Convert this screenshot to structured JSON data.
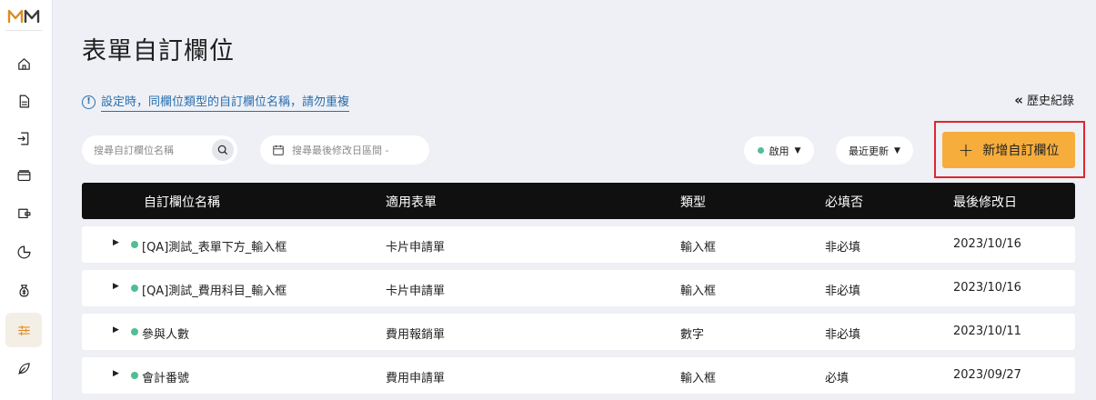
{
  "brand": {
    "logo_text": "MM",
    "accent": "#e08a23"
  },
  "sidebar": {
    "items": [
      {
        "icon": "home-icon"
      },
      {
        "icon": "document-icon"
      },
      {
        "icon": "import-icon"
      },
      {
        "icon": "card-icon"
      },
      {
        "icon": "wallet-icon"
      },
      {
        "icon": "pie-chart-icon"
      },
      {
        "icon": "money-bag-icon"
      },
      {
        "icon": "sliders-icon",
        "active": true
      },
      {
        "icon": "leaf-icon"
      }
    ]
  },
  "page": {
    "title": "表單自訂欄位",
    "notice": "設定時，同欄位類型的自訂欄位名稱，請勿重複",
    "history_label": "歷史紀錄"
  },
  "toolbar": {
    "search_placeholder": "搜尋自訂欄位名稱",
    "date_placeholder": "搜尋最後修改日區間 -",
    "status_label": "啟用",
    "sort_label": "最近更新",
    "add_button_label": "新增自訂欄位",
    "highlight_color": "#e0252f",
    "button_color": "#f6ad3c"
  },
  "table": {
    "columns": [
      "自訂欄位名稱",
      "適用表單",
      "類型",
      "必填否",
      "最後修改日"
    ],
    "rows": [
      {
        "name": "[QA]測試_表單下方_輸入框",
        "form": "卡片申請單",
        "type": "輸入框",
        "required": "非必填",
        "date": "2023/10/16"
      },
      {
        "name": "[QA]測試_費用科目_輸入框",
        "form": "卡片申請單",
        "type": "輸入框",
        "required": "非必填",
        "date": "2023/10/16"
      },
      {
        "name": "參與人數",
        "form": "費用報銷單",
        "type": "數字",
        "required": "非必填",
        "date": "2023/10/11"
      },
      {
        "name": "會計番號",
        "form": "費用申請單",
        "type": "輸入框",
        "required": "必填",
        "date": "2023/09/27"
      }
    ]
  }
}
